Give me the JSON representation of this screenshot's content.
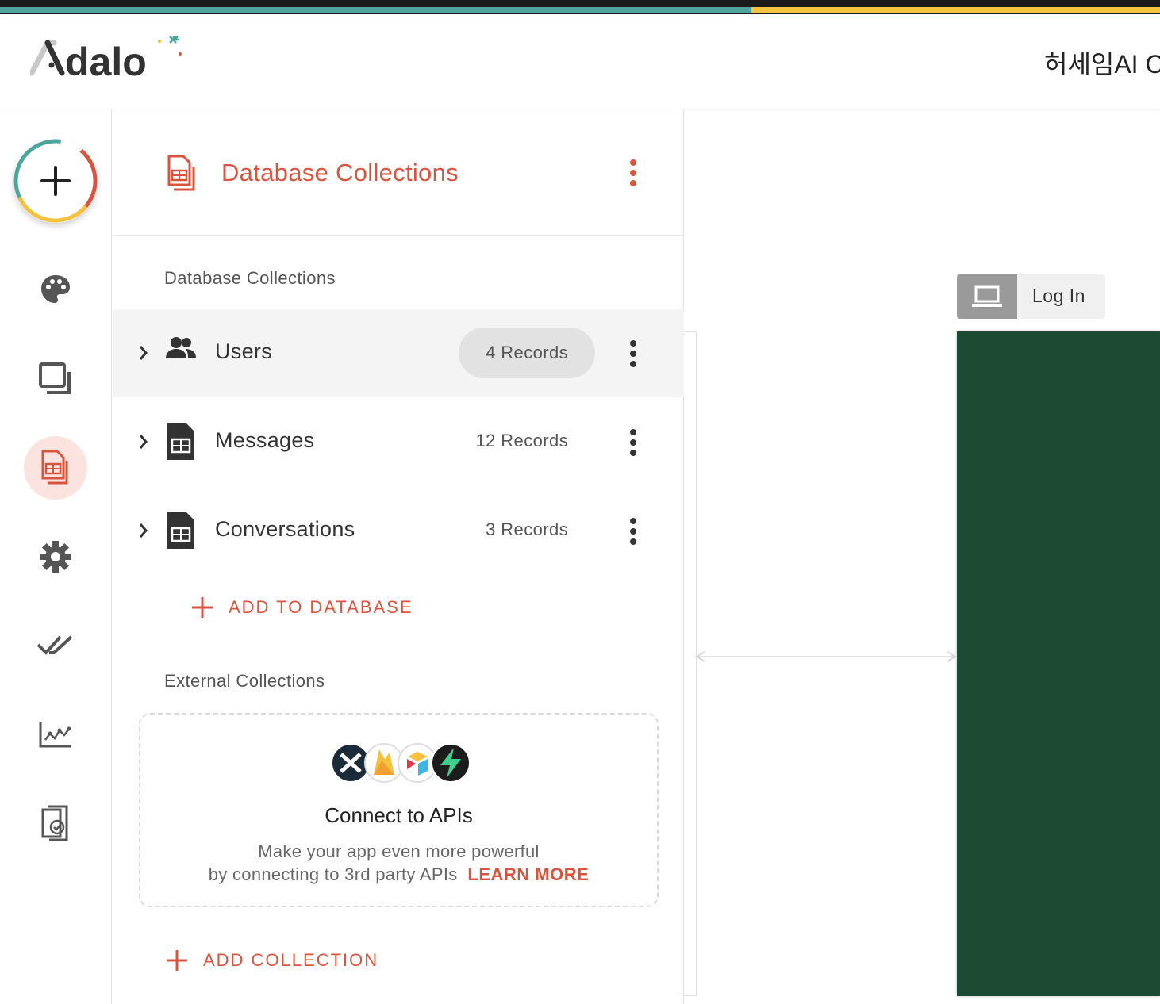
{
  "header": {
    "logo_text": "Adalo",
    "app_name": "허세임AI C"
  },
  "nav": {
    "items": [
      "add",
      "branding",
      "screens",
      "database",
      "settings",
      "publish",
      "analytics",
      "app-access"
    ],
    "active": "database"
  },
  "panel": {
    "title": "Database Collections",
    "db_section_label": "Database Collections",
    "collections": [
      {
        "name": "Users",
        "count": "4 Records",
        "icon": "users-icon",
        "highlighted": true
      },
      {
        "name": "Messages",
        "count": "12 Records",
        "icon": "collection-table-icon",
        "highlighted": false
      },
      {
        "name": "Conversations",
        "count": "3 Records",
        "icon": "collection-table-icon",
        "highlighted": false
      }
    ],
    "add_to_database": "ADD TO DATABASE",
    "ext_section_label": "External Collections",
    "external": {
      "title": "Connect to APIs",
      "desc_line1": "Make your app even more powerful",
      "desc_line2": "by connecting to 3rd party APIs",
      "learn_more": "LEARN MORE"
    },
    "add_collection": "ADD COLLECTION"
  },
  "canvas": {
    "screen_label": "Log In",
    "screen_bg": "#1d4a33"
  },
  "colors": {
    "accent": "#d9543e",
    "teal": "#4da59b",
    "yellow": "#f5c23e"
  }
}
